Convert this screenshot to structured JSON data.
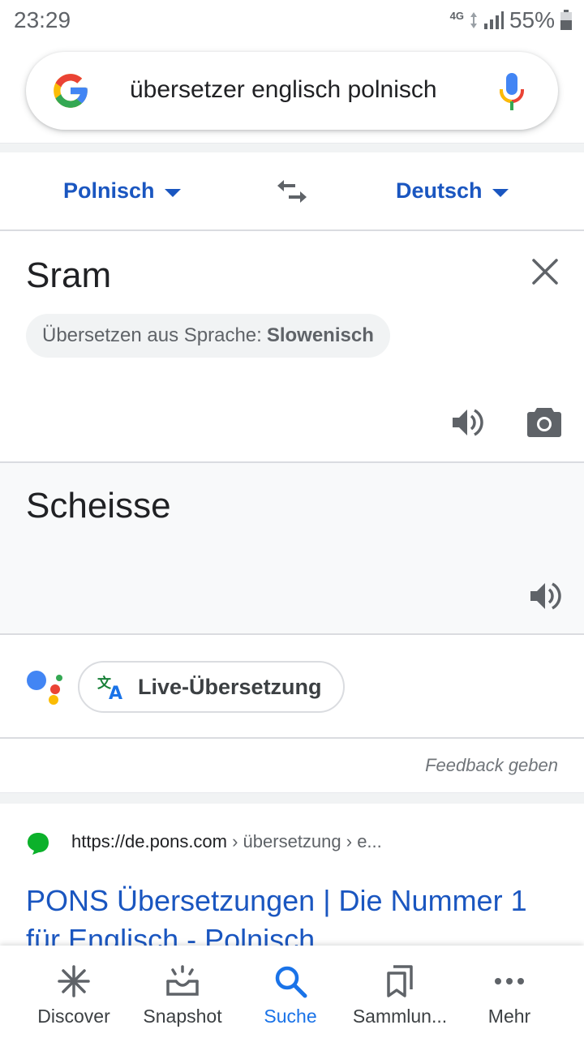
{
  "status_bar": {
    "time": "23:29",
    "network": "4G",
    "battery": "55%"
  },
  "search": {
    "query": "übersetzer englisch polnisch"
  },
  "translator": {
    "source_language": "Polnisch",
    "target_language": "Deutsch",
    "source_text": "Sram",
    "detect_prefix": "Übersetzen aus Sprache:",
    "detected_language": "Slowenisch",
    "target_text": "Scheisse",
    "live_translate_label": "Live-Übersetzung",
    "feedback_label": "Feedback geben"
  },
  "result": {
    "url_domain": "https://de.pons.com",
    "url_crumbs": " › übersetzung › e...",
    "title": "PONS Übersetzungen | Die Nummer 1 für Englisch - Polnisch"
  },
  "bottom_nav": {
    "items": [
      {
        "label": "Discover",
        "icon": "asterisk-icon"
      },
      {
        "label": "Snapshot",
        "icon": "snapshot-icon"
      },
      {
        "label": "Suche",
        "icon": "search-icon",
        "active": true
      },
      {
        "label": "Sammlun...",
        "icon": "bookmarks-icon"
      },
      {
        "label": "Mehr",
        "icon": "more-dots-icon"
      }
    ]
  },
  "colors": {
    "link_blue": "#1a56c0",
    "active_blue": "#1a73e8",
    "google_blue": "#4285f4",
    "google_red": "#ea4335",
    "google_yellow": "#fbbc05",
    "google_green": "#34a853",
    "favicon_green": "#0cb12b"
  }
}
